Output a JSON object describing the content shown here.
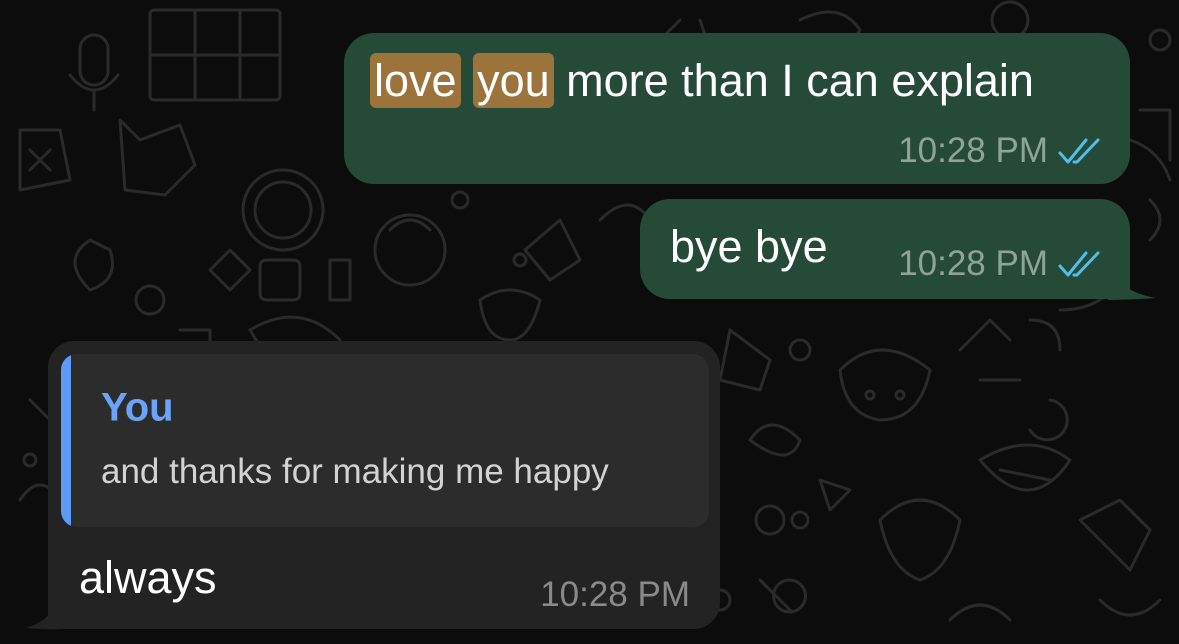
{
  "messages": [
    {
      "direction": "outgoing",
      "highlighted": [
        "love",
        "you"
      ],
      "text_rest": "more than I can explain",
      "time": "10:28 PM",
      "status_icon": "double-check-icon"
    },
    {
      "direction": "outgoing",
      "text": "bye bye",
      "time": "10:28 PM",
      "status_icon": "double-check-icon"
    },
    {
      "direction": "incoming",
      "reply": {
        "author": "You",
        "text": "and thanks for making me happy"
      },
      "text": "always",
      "time": "10:28 PM"
    }
  ],
  "colors": {
    "background": "#0c0c0c",
    "outgoing_bubble": "#254a37",
    "incoming_bubble": "#232323",
    "search_highlight": "#9c733a",
    "read_receipt": "#53bdeb",
    "reply_accent": "#5c9cf6"
  }
}
